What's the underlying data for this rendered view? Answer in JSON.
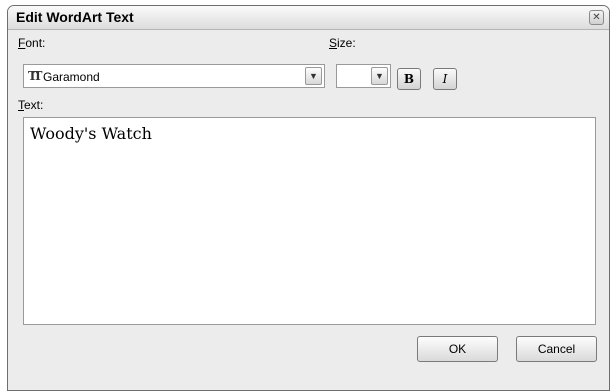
{
  "dialog": {
    "title": "Edit WordArt Text",
    "close_icon": "close-icon"
  },
  "font": {
    "label_accel": "F",
    "label_rest": "ont:",
    "value": "Garamond",
    "icon": "truetype-font-icon",
    "icon_glyph": "TT"
  },
  "size": {
    "label_accel": "S",
    "label_rest": "ize:",
    "value": ""
  },
  "format": {
    "bold_label": "B",
    "italic_label": "I"
  },
  "text": {
    "label_accel": "T",
    "label_rest": "ext:",
    "value": "Woody's Watch"
  },
  "buttons": {
    "ok_label": "OK",
    "cancel_label": "Cancel"
  }
}
